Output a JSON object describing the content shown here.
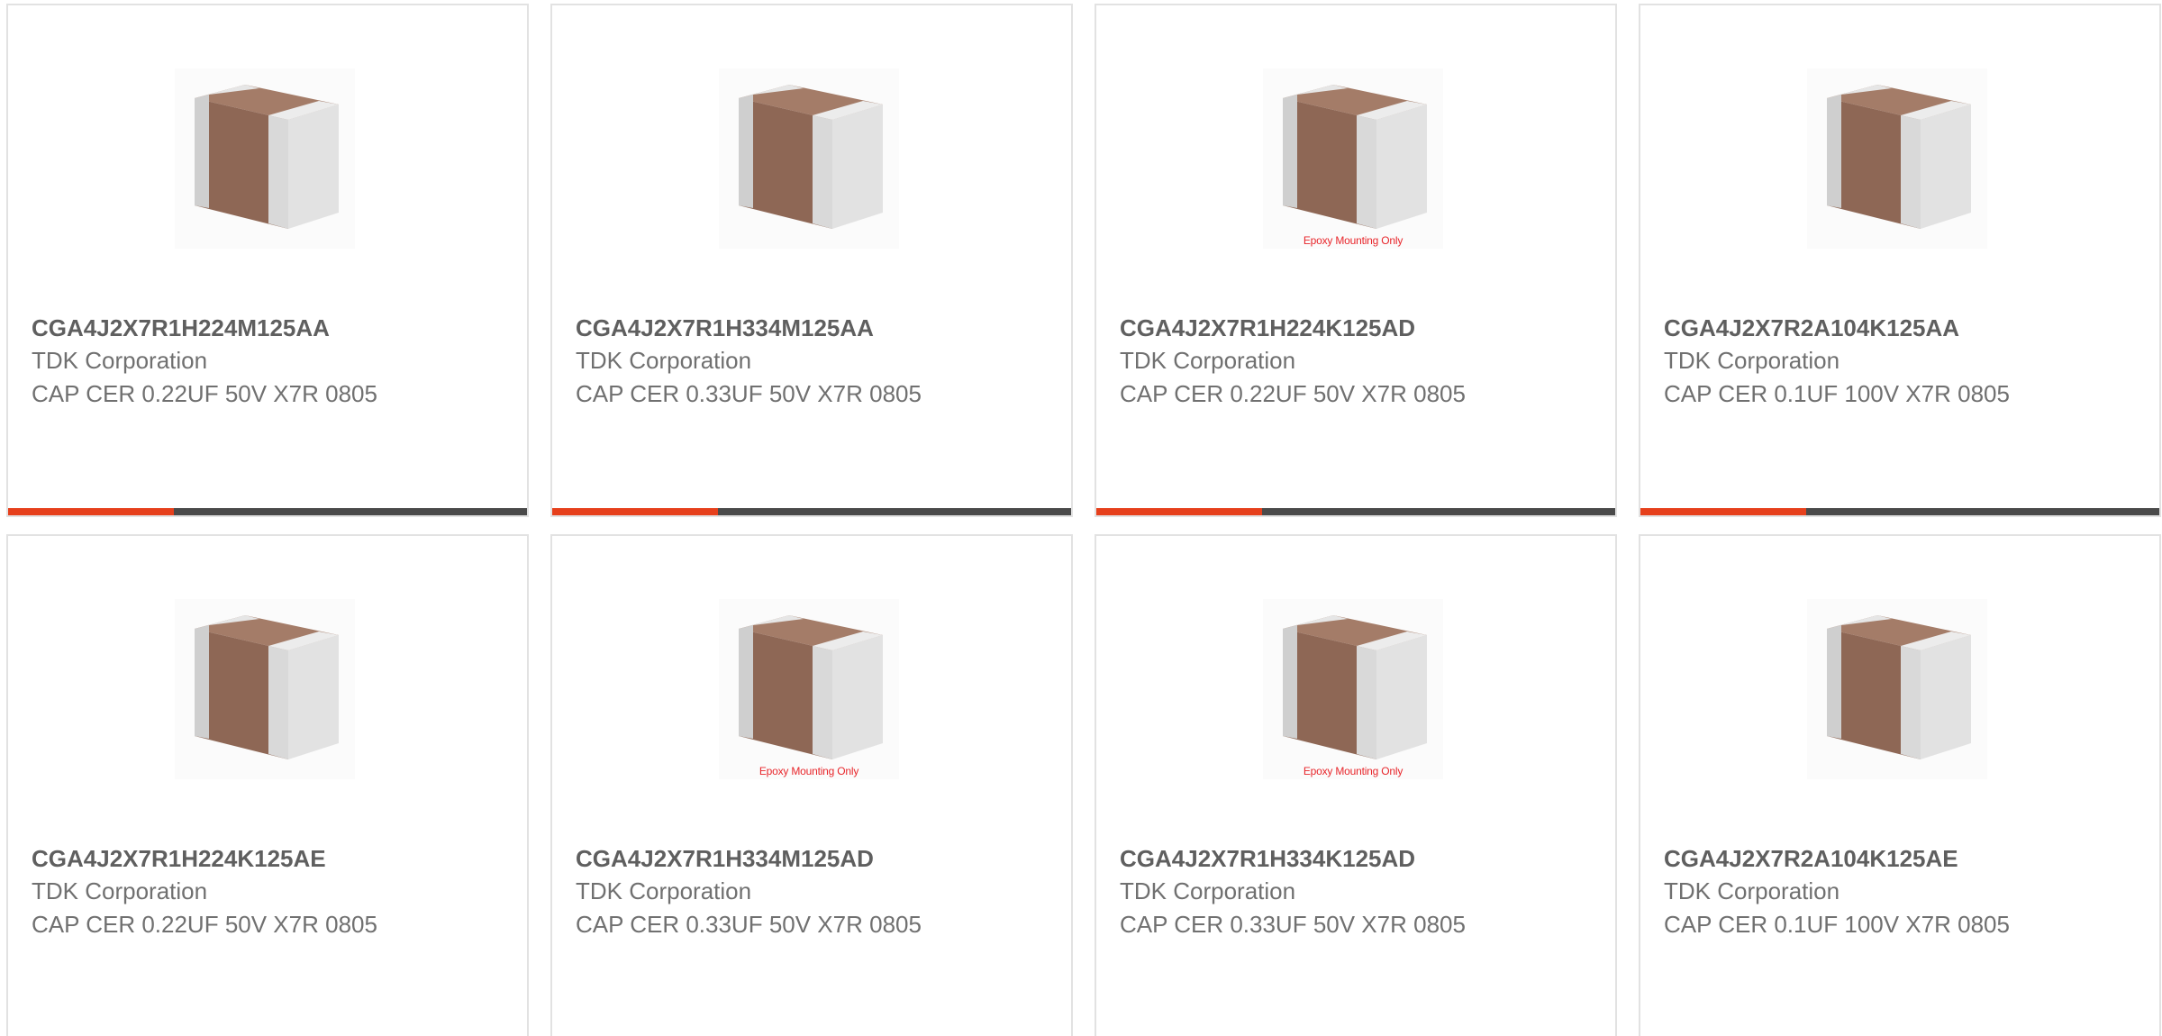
{
  "colors": {
    "accent": "#e6401c",
    "bar_track": "#4a4a4a",
    "part_number": "#5f5f5f",
    "body_text": "#707070",
    "epoxy_text": "#e8262b"
  },
  "products": [
    {
      "part_number": "CGA4J2X7R1H224M125AA",
      "manufacturer": "TDK Corporation",
      "description": "CAP CER 0.22UF 50V X7R 0805",
      "image_icon": "capacitor-chip-image",
      "image_caption": "",
      "progress": 0.32
    },
    {
      "part_number": "CGA4J2X7R1H334M125AA",
      "manufacturer": "TDK Corporation",
      "description": "CAP CER 0.33UF 50V X7R 0805",
      "image_icon": "capacitor-chip-image",
      "image_caption": "",
      "progress": 0.32
    },
    {
      "part_number": "CGA4J2X7R1H224K125AD",
      "manufacturer": "TDK Corporation",
      "description": "CAP CER 0.22UF 50V X7R 0805",
      "image_icon": "capacitor-chip-image",
      "image_caption": "Epoxy Mounting Only",
      "progress": 0.32
    },
    {
      "part_number": "CGA4J2X7R2A104K125AA",
      "manufacturer": "TDK Corporation",
      "description": "CAP CER 0.1UF 100V X7R 0805",
      "image_icon": "capacitor-chip-image",
      "image_caption": "",
      "progress": 0.32
    },
    {
      "part_number": "CGA4J2X7R1H224K125AE",
      "manufacturer": "TDK Corporation",
      "description": "CAP CER 0.22UF 50V X7R 0805",
      "image_icon": "capacitor-chip-image",
      "image_caption": ""
    },
    {
      "part_number": "CGA4J2X7R1H334M125AD",
      "manufacturer": "TDK Corporation",
      "description": "CAP CER 0.33UF 50V X7R 0805",
      "image_icon": "capacitor-chip-image",
      "image_caption": "Epoxy Mounting Only"
    },
    {
      "part_number": "CGA4J2X7R1H334K125AD",
      "manufacturer": "TDK Corporation",
      "description": "CAP CER 0.33UF 50V X7R 0805",
      "image_icon": "capacitor-chip-image",
      "image_caption": "Epoxy Mounting Only"
    },
    {
      "part_number": "CGA4J2X7R2A104K125AE",
      "manufacturer": "TDK Corporation",
      "description": "CAP CER 0.1UF 100V X7R 0805",
      "image_icon": "capacitor-chip-image",
      "image_caption": ""
    }
  ]
}
